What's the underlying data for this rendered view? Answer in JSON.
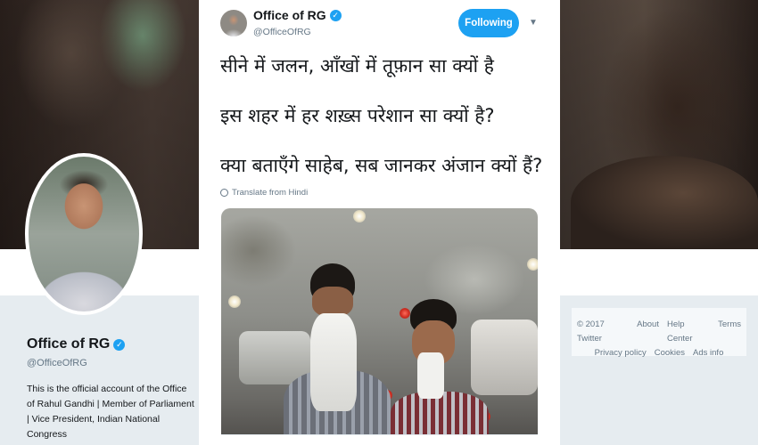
{
  "profile": {
    "name": "Office of RG",
    "handle": "@OfficeOfRG",
    "bio": "This is the official account of the Office of Rahul Gandhi | Member of Parliament | Vice President, Indian National Congress"
  },
  "footer": {
    "row1": [
      "© 2017 Twitter",
      "About",
      "Help Center",
      "Terms"
    ],
    "row2": [
      "Privacy policy",
      "Cookies",
      "Ads info"
    ]
  },
  "tweet": {
    "name": "Office of RG",
    "handle": "@OfficeOfRG",
    "follow_label": "Following",
    "lines": [
      "सीने में जलन, आँखों में तूफ़ान सा क्यों है",
      "इस शहर में हर शख़्स परेशान सा क्यों है?",
      "क्या बताएँगे साहेब, सब जानकर अंजान क्यों हैं?"
    ],
    "translate_label": "Translate from Hindi"
  },
  "colors": {
    "accent": "#1da1f2",
    "text": "#14171a",
    "muted": "#657786"
  },
  "icons": {
    "verified": "verified-badge-icon",
    "more": "chevron-down-icon",
    "translate": "globe-icon"
  }
}
